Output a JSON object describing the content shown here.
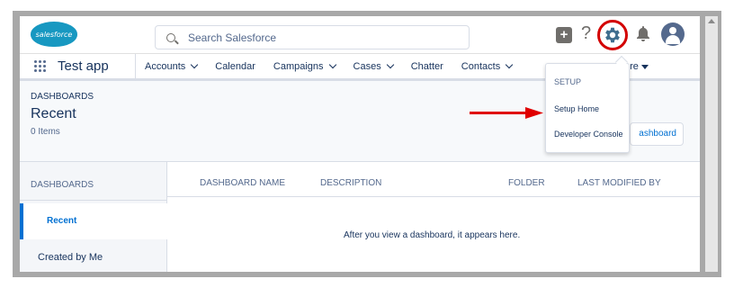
{
  "app": {
    "logo_text": "salesforce",
    "brand_color": "#1798c1"
  },
  "search": {
    "placeholder": "Search Salesforce"
  },
  "header_icons": [
    "plus-icon",
    "help-icon",
    "gear-icon",
    "bell-icon",
    "avatar"
  ],
  "nav": {
    "app_name": "Test app",
    "items": [
      {
        "label": "Accounts",
        "has_menu": true
      },
      {
        "label": "Calendar",
        "has_menu": false
      },
      {
        "label": "Campaigns",
        "has_menu": true
      },
      {
        "label": "Cases",
        "has_menu": true
      },
      {
        "label": "Chatter",
        "has_menu": false
      },
      {
        "label": "Contacts",
        "has_menu": true
      }
    ],
    "more_label": "ore"
  },
  "page_header": {
    "eyebrow": "DASHBOARDS",
    "title": "Recent",
    "count": "0 Items",
    "new_button_label": "ashboard"
  },
  "sidebar": {
    "heading": "DASHBOARDS",
    "items": [
      {
        "label": "Recent",
        "active": true
      },
      {
        "label": "Created by Me",
        "active": false
      }
    ]
  },
  "table": {
    "columns": [
      "DASHBOARD NAME",
      "DESCRIPTION",
      "FOLDER",
      "LAST MODIFIED BY"
    ],
    "empty_message": "After you view a dashboard, it appears here."
  },
  "setup_menu": {
    "heading": "SETUP",
    "items": [
      "Setup Home",
      "Developer Console"
    ]
  },
  "colors": {
    "accent": "#0070d2",
    "highlight_ring": "#d30000",
    "annotation_arrow": "#e00000"
  }
}
